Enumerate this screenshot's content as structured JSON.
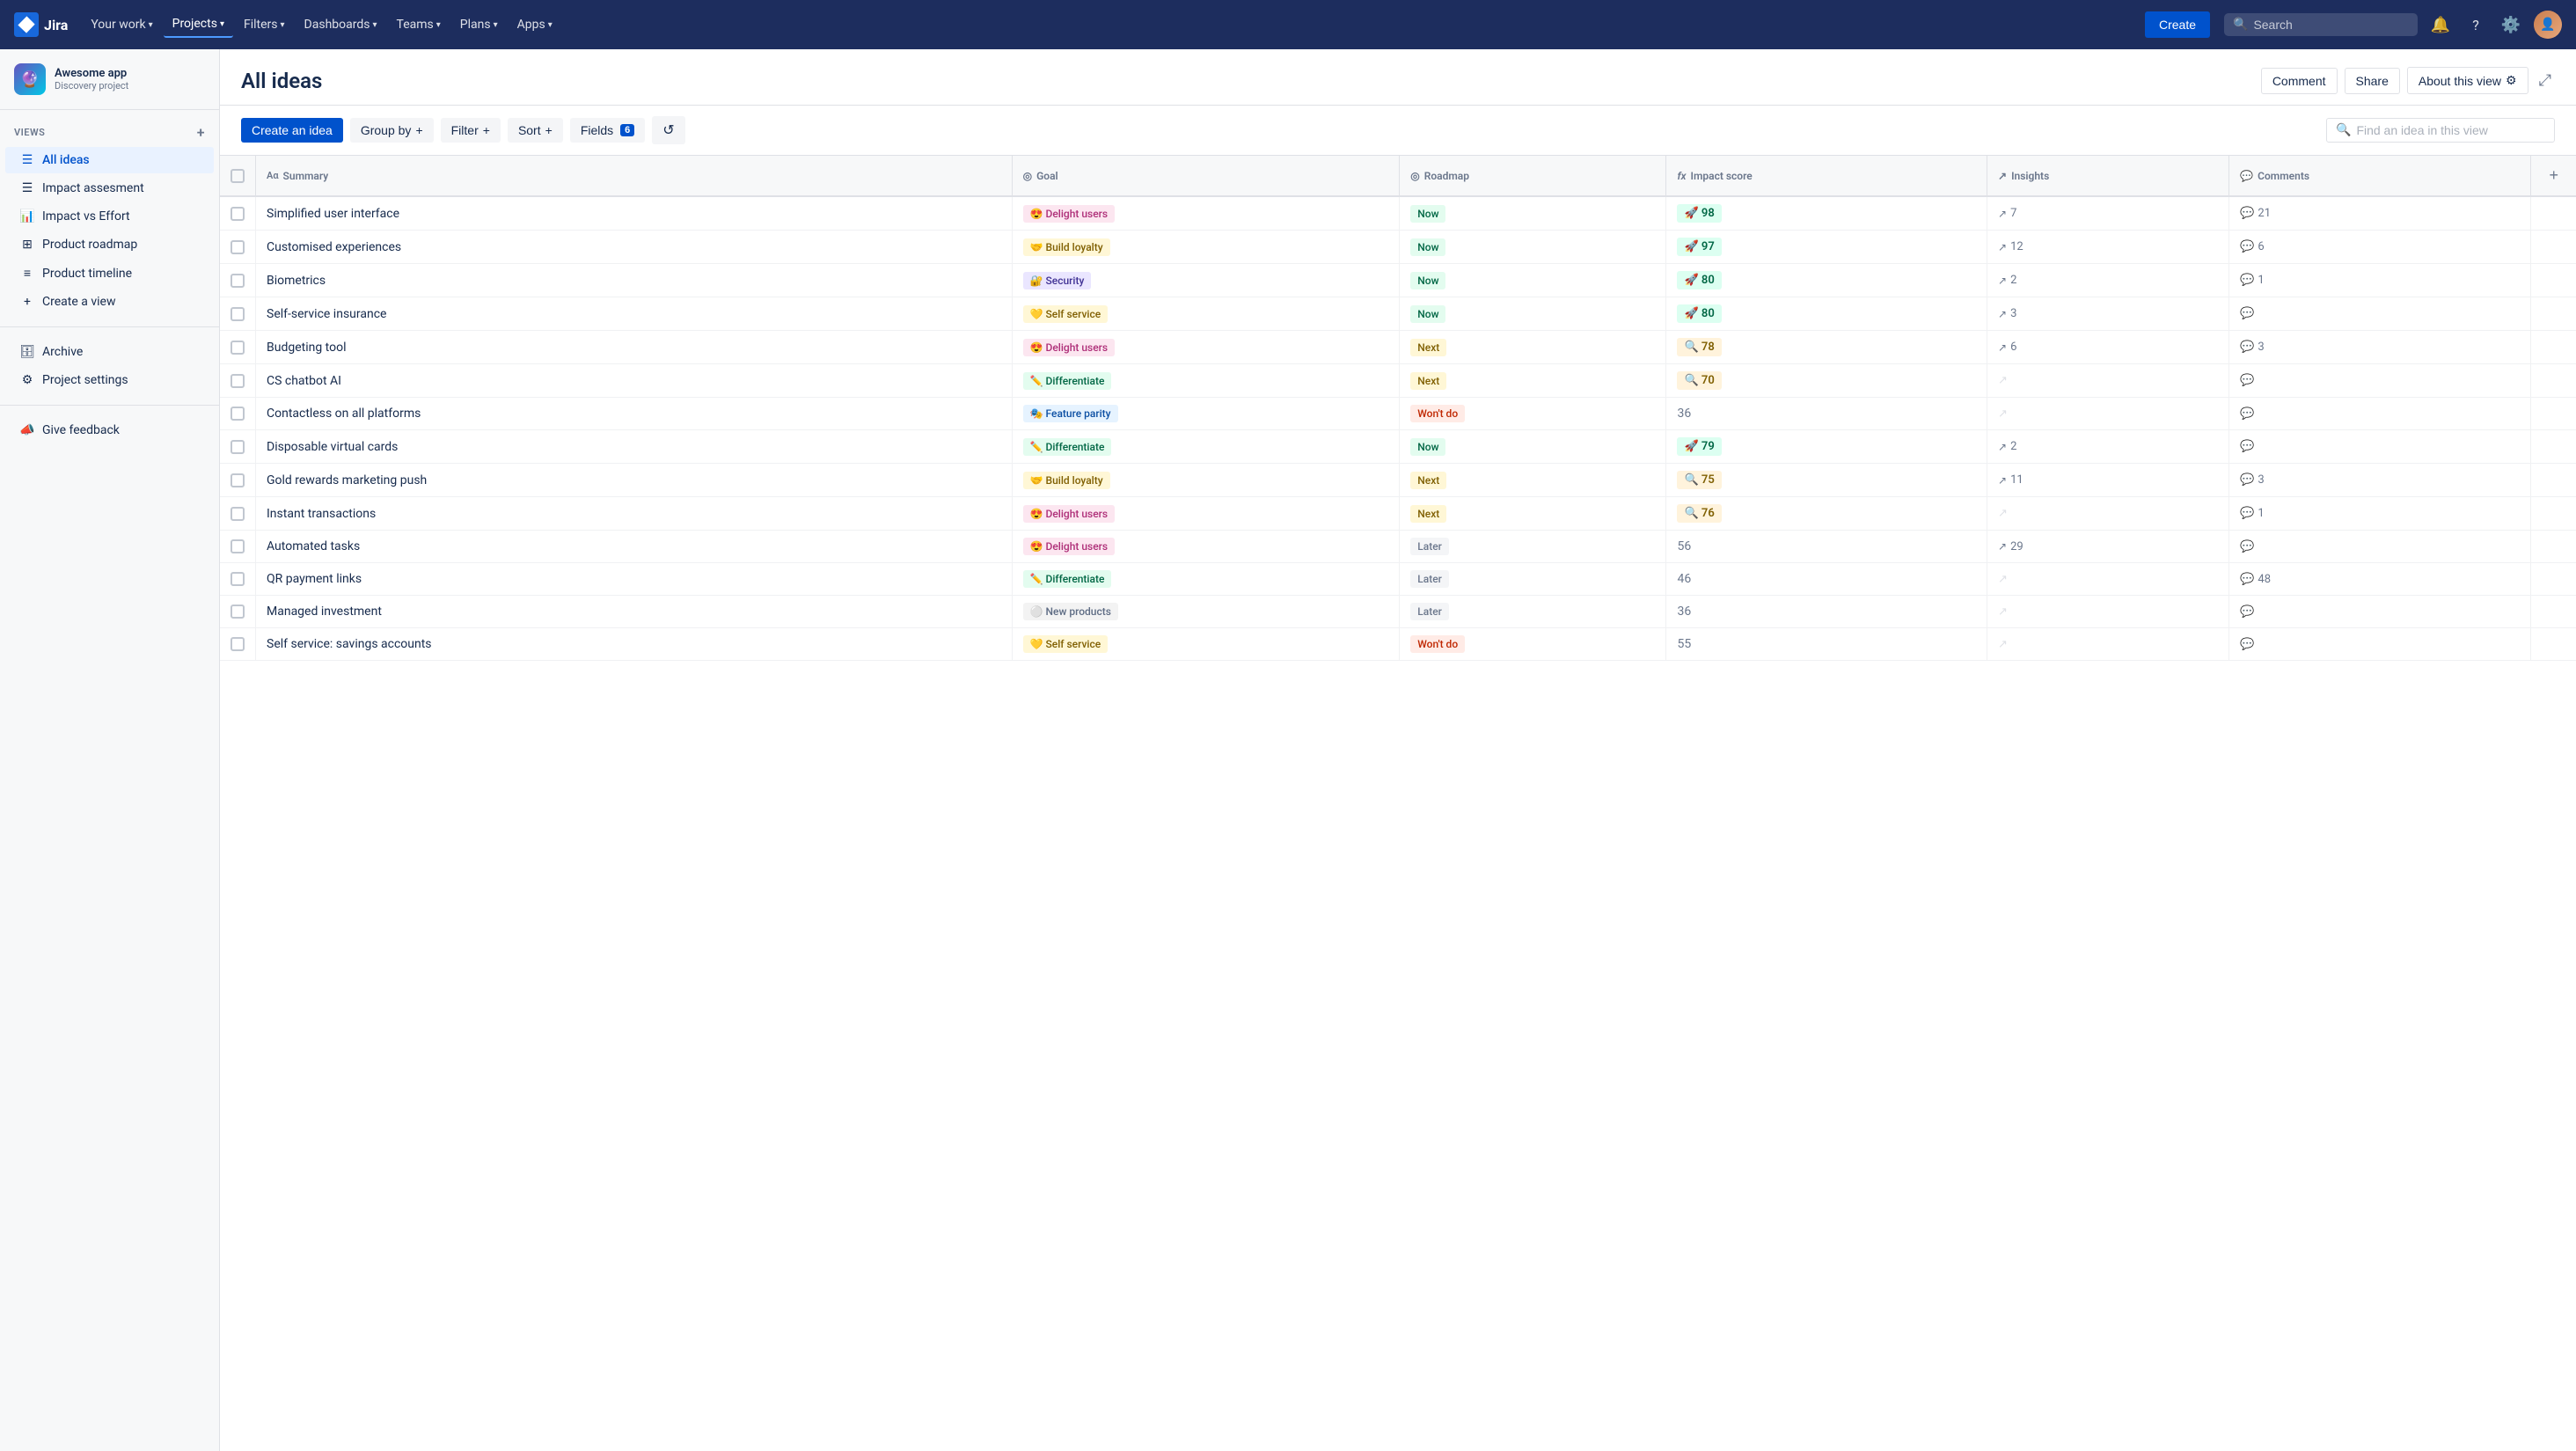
{
  "topnav": {
    "logo_text": "Jira",
    "nav_items": [
      {
        "label": "Your work",
        "dropdown": true,
        "active": false
      },
      {
        "label": "Projects",
        "dropdown": true,
        "active": true
      },
      {
        "label": "Filters",
        "dropdown": true,
        "active": false
      },
      {
        "label": "Dashboards",
        "dropdown": true,
        "active": false
      },
      {
        "label": "Teams",
        "dropdown": true,
        "active": false
      },
      {
        "label": "Plans",
        "dropdown": true,
        "active": false
      },
      {
        "label": "Apps",
        "dropdown": true,
        "active": false
      }
    ],
    "create_label": "Create",
    "search_placeholder": "Search",
    "icons": [
      "bell",
      "question",
      "settings"
    ]
  },
  "sidebar": {
    "project_name": "Awesome app",
    "project_type": "Discovery project",
    "views_label": "VIEWS",
    "nav_items": [
      {
        "id": "all-ideas",
        "label": "All ideas",
        "icon": "list",
        "active": true
      },
      {
        "id": "impact-assessment",
        "label": "Impact assesment",
        "icon": "list",
        "active": false
      },
      {
        "id": "impact-vs-effort",
        "label": "Impact vs Effort",
        "icon": "chart",
        "active": false
      },
      {
        "id": "product-roadmap",
        "label": "Product roadmap",
        "icon": "grid",
        "active": false
      },
      {
        "id": "product-timeline",
        "label": "Product timeline",
        "icon": "timeline",
        "active": false
      },
      {
        "id": "create-view",
        "label": "Create a view",
        "icon": "plus",
        "active": false
      }
    ],
    "bottom_items": [
      {
        "id": "archive",
        "label": "Archive",
        "icon": "archive"
      },
      {
        "id": "project-settings",
        "label": "Project settings",
        "icon": "settings"
      },
      {
        "id": "give-feedback",
        "label": "Give feedback",
        "icon": "megaphone"
      }
    ]
  },
  "page": {
    "title": "All ideas",
    "header_buttons": [
      {
        "label": "Comment"
      },
      {
        "label": "Share"
      },
      {
        "label": "About this view"
      }
    ],
    "toolbar": {
      "create_label": "Create an idea",
      "group_label": "Group by",
      "filter_label": "Filter",
      "sort_label": "Sort",
      "fields_label": "Fields",
      "fields_count": "6",
      "search_placeholder": "Find an idea in this view"
    },
    "table": {
      "columns": [
        {
          "id": "checkbox",
          "label": ""
        },
        {
          "id": "summary",
          "label": "Summary",
          "icon": "text"
        },
        {
          "id": "goal",
          "label": "Goal",
          "icon": "circle"
        },
        {
          "id": "roadmap",
          "label": "Roadmap",
          "icon": "circle"
        },
        {
          "id": "impact",
          "label": "Impact score",
          "icon": "fx"
        },
        {
          "id": "insights",
          "label": "Insights",
          "icon": "trend"
        },
        {
          "id": "comments",
          "label": "Comments",
          "icon": "comment"
        }
      ],
      "rows": [
        {
          "summary": "Simplified user interface",
          "goal_emoji": "😍",
          "goal_label": "Delight users",
          "goal_class": "goal-delight",
          "roadmap": "Now",
          "roadmap_class": "roadmap-now",
          "score": "98",
          "score_emoji": "🚀",
          "score_class": "score-high",
          "insights": "7",
          "comments": "21"
        },
        {
          "summary": "Customised experiences",
          "goal_emoji": "🤝",
          "goal_label": "Build loyalty",
          "goal_class": "goal-loyalty",
          "roadmap": "Now",
          "roadmap_class": "roadmap-now",
          "score": "97",
          "score_emoji": "🚀",
          "score_class": "score-high",
          "insights": "12",
          "comments": "6"
        },
        {
          "summary": "Biometrics",
          "goal_emoji": "🔐",
          "goal_label": "Security",
          "goal_class": "goal-security",
          "roadmap": "Now",
          "roadmap_class": "roadmap-now",
          "score": "80",
          "score_emoji": "🚀",
          "score_class": "score-high",
          "insights": "2",
          "comments": "1"
        },
        {
          "summary": "Self-service insurance",
          "goal_emoji": "💛",
          "goal_label": "Self service",
          "goal_class": "goal-self",
          "roadmap": "Now",
          "roadmap_class": "roadmap-now",
          "score": "80",
          "score_emoji": "🚀",
          "score_class": "score-high",
          "insights": "3",
          "comments": ""
        },
        {
          "summary": "Budgeting tool",
          "goal_emoji": "😍",
          "goal_label": "Delight users",
          "goal_class": "goal-delight",
          "roadmap": "Next",
          "roadmap_class": "roadmap-next",
          "score": "78",
          "score_emoji": "🔍",
          "score_class": "score-med",
          "insights": "6",
          "comments": "3"
        },
        {
          "summary": "CS chatbot AI",
          "goal_emoji": "✏️",
          "goal_label": "Differentiate",
          "goal_class": "goal-differentiate",
          "roadmap": "Next",
          "roadmap_class": "roadmap-next",
          "score": "70",
          "score_emoji": "🔍",
          "score_class": "score-med",
          "insights": "",
          "comments": ""
        },
        {
          "summary": "Contactless on all platforms",
          "goal_emoji": "🎭",
          "goal_label": "Feature parity",
          "goal_class": "goal-feature",
          "roadmap": "Won't do",
          "roadmap_class": "roadmap-wontdo",
          "score": "36",
          "score_emoji": "",
          "score_class": "score-none",
          "insights": "",
          "comments": ""
        },
        {
          "summary": "Disposable virtual cards",
          "goal_emoji": "✏️",
          "goal_label": "Differentiate",
          "goal_class": "goal-differentiate",
          "roadmap": "Now",
          "roadmap_class": "roadmap-now",
          "score": "79",
          "score_emoji": "🚀",
          "score_class": "score-high",
          "insights": "2",
          "comments": ""
        },
        {
          "summary": "Gold rewards marketing push",
          "goal_emoji": "🤝",
          "goal_label": "Build loyalty",
          "goal_class": "goal-loyalty",
          "roadmap": "Next",
          "roadmap_class": "roadmap-next",
          "score": "75",
          "score_emoji": "🔍",
          "score_class": "score-med",
          "insights": "11",
          "comments": "3"
        },
        {
          "summary": "Instant transactions",
          "goal_emoji": "😍",
          "goal_label": "Delight users",
          "goal_class": "goal-delight",
          "roadmap": "Next",
          "roadmap_class": "roadmap-next",
          "score": "76",
          "score_emoji": "🔍",
          "score_class": "score-med",
          "insights": "",
          "comments": "1"
        },
        {
          "summary": "Automated tasks",
          "goal_emoji": "😍",
          "goal_label": "Delight users",
          "goal_class": "goal-delight",
          "roadmap": "Later",
          "roadmap_class": "roadmap-later",
          "score": "56",
          "score_emoji": "",
          "score_class": "score-none",
          "insights": "29",
          "comments": ""
        },
        {
          "summary": "QR payment links",
          "goal_emoji": "✏️",
          "goal_label": "Differentiate",
          "goal_class": "goal-differentiate",
          "roadmap": "Later",
          "roadmap_class": "roadmap-later",
          "score": "46",
          "score_emoji": "",
          "score_class": "score-none",
          "insights": "",
          "comments": "48"
        },
        {
          "summary": "Managed investment",
          "goal_emoji": "⚪",
          "goal_label": "New products",
          "goal_class": "goal-new",
          "roadmap": "Later",
          "roadmap_class": "roadmap-later",
          "score": "36",
          "score_emoji": "",
          "score_class": "score-none",
          "insights": "",
          "comments": ""
        },
        {
          "summary": "Self service: savings accounts",
          "goal_emoji": "💛",
          "goal_label": "Self service",
          "goal_class": "goal-self",
          "roadmap": "Won't do",
          "roadmap_class": "roadmap-wontdo",
          "score": "55",
          "score_emoji": "",
          "score_class": "score-none",
          "insights": "",
          "comments": ""
        }
      ]
    }
  }
}
